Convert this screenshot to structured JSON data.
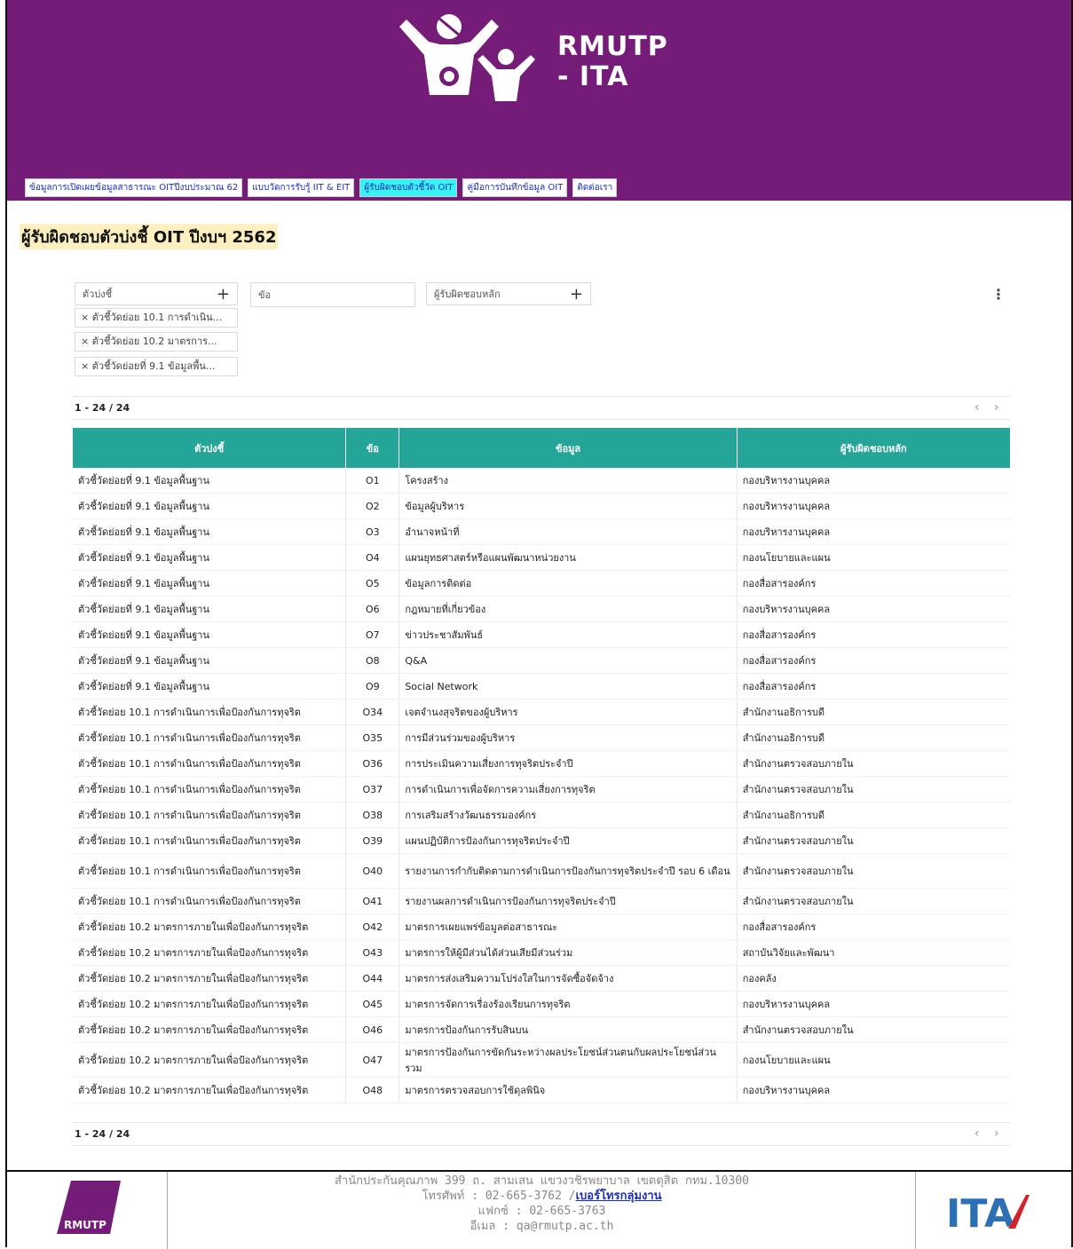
{
  "header": {
    "logo_text_line1": "RMUTP",
    "logo_text_line2": "- ITA"
  },
  "nav": [
    "ข้อมูลการเปิดเผยข้อมูลสาธารณะ OITปีงบประมาณ 62",
    "แบบวัดการรับรู้ IIT & EIT",
    "ผู้รับผิดชอบตัวชี้วัด OIT",
    "คู่มือการบันทึกข้อมูล OIT",
    "ติดต่อเรา"
  ],
  "page_title": "ผู้รับผิดชอบตัวบ่งชี้ OIT ปีงบฯ 2562",
  "filters": {
    "indicator_label": "ตัวบ่งชี้",
    "item_placeholder": "ข้อ",
    "owner_label": "ผู้รับผิดชอบหลัก",
    "plus": "+",
    "chips": [
      "× ตัวชี้วัดย่อย 10.1 การดำเนิน...",
      "× ตัวชี้วัดย่อย 10.2 มาตรการ...",
      "× ตัวชี้วัดย่อยที่ 9.1 ข้อมูลพื้น..."
    ]
  },
  "pager": {
    "text": "1 - 24 / 24",
    "arrows": "‹ ›"
  },
  "table": {
    "headers": [
      "ตัวบ่งชี้",
      "ข้อ",
      "ข้อมูล",
      "ผู้รับผิดชอบหลัก"
    ],
    "rows": [
      [
        "ตัวชี้วัดย่อยที่ 9.1 ข้อมูลพื้นฐาน",
        "O1",
        "โครงสร้าง",
        "กองบริหารงานบุคคล"
      ],
      [
        "ตัวชี้วัดย่อยที่ 9.1 ข้อมูลพื้นฐาน",
        "O2",
        "ข้อมูลผู้บริหาร",
        "กองบริหารงานบุคคล"
      ],
      [
        "ตัวชี้วัดย่อยที่ 9.1 ข้อมูลพื้นฐาน",
        "O3",
        "อำนาจหน้าที่",
        "กองบริหารงานบุคคล"
      ],
      [
        "ตัวชี้วัดย่อยที่ 9.1 ข้อมูลพื้นฐาน",
        "O4",
        "แผนยุทธศาสตร์หรือแผนพัฒนาหน่วยงาน",
        "กองนโยบายและแผน"
      ],
      [
        "ตัวชี้วัดย่อยที่ 9.1 ข้อมูลพื้นฐาน",
        "O5",
        "ข้อมูลการติดต่อ",
        "กองสื่อสารองค์กร"
      ],
      [
        "ตัวชี้วัดย่อยที่ 9.1 ข้อมูลพื้นฐาน",
        "O6",
        "กฎหมายที่เกี่ยวข้อง",
        "กองบริหารงานบุคคล"
      ],
      [
        "ตัวชี้วัดย่อยที่ 9.1 ข้อมูลพื้นฐาน",
        "O7",
        "ข่าวประชาสัมพันธ์",
        "กองสื่อสารองค์กร"
      ],
      [
        "ตัวชี้วัดย่อยที่ 9.1 ข้อมูลพื้นฐาน",
        "O8",
        "Q&A",
        "กองสื่อสารองค์กร"
      ],
      [
        "ตัวชี้วัดย่อยที่ 9.1 ข้อมูลพื้นฐาน",
        "O9",
        "Social Network",
        "กองสื่อสารองค์กร"
      ],
      [
        "ตัวชี้วัดย่อย 10.1 การดำเนินการเพื่อป้องกันการทุจริต",
        "O34",
        "เจตจำนงสุจริตของผู้บริหาร",
        "สำนักงานอธิการบดี"
      ],
      [
        "ตัวชี้วัดย่อย 10.1 การดำเนินการเพื่อป้องกันการทุจริต",
        "O35",
        "การมีส่วนร่วมของผู้บริหาร",
        "สำนักงานอธิการบดี"
      ],
      [
        "ตัวชี้วัดย่อย 10.1 การดำเนินการเพื่อป้องกันการทุจริต",
        "O36",
        "การประเมินความเสี่ยงการทุจริตประจำปี",
        "สำนักงานตรวจสอบภายใน"
      ],
      [
        "ตัวชี้วัดย่อย 10.1 การดำเนินการเพื่อป้องกันการทุจริต",
        "O37",
        "การดำเนินการเพื่อจัดการความเสี่ยงการทุจริต",
        "สำนักงานตรวจสอบภายใน"
      ],
      [
        "ตัวชี้วัดย่อย 10.1 การดำเนินการเพื่อป้องกันการทุจริต",
        "O38",
        "การเสริมสร้างวัฒนธรรมองค์กร",
        "สำนักงานอธิการบดี"
      ],
      [
        "ตัวชี้วัดย่อย 10.1 การดำเนินการเพื่อป้องกันการทุจริต",
        "O39",
        "แผนปฏิบัติการป้องกันการทุจริตประจำปี",
        "สำนักงานตรวจสอบภายใน"
      ],
      [
        "ตัวชี้วัดย่อย 10.1 การดำเนินการเพื่อป้องกันการทุจริต",
        "O40",
        "รายงานการกำกับติดตามการดำเนินการป้องกันการทุจริตประจำปี รอบ 6 เดือน",
        "สำนักงานตรวจสอบภายใน"
      ],
      [
        "ตัวชี้วัดย่อย 10.1 การดำเนินการเพื่อป้องกันการทุจริต",
        "O41",
        "รายงานผลการดำเนินการป้องกันการทุจริตประจำปี",
        "สำนักงานตรวจสอบภายใน"
      ],
      [
        "ตัวชี้วัดย่อย 10.2 มาตรการภายในเพื่อป้องกันการทุจริต",
        "O42",
        "มาตรการเผยแพร่ข้อมูลต่อสาธารณะ",
        "กองสื่อสารองค์กร"
      ],
      [
        "ตัวชี้วัดย่อย 10.2 มาตรการภายในเพื่อป้องกันการทุจริต",
        "O43",
        "มาตรการให้ผู้มีส่วนได้ส่วนเสียมีส่วนร่วม",
        "สถาบันวิจัยและพัฒนา"
      ],
      [
        "ตัวชี้วัดย่อย 10.2 มาตรการภายในเพื่อป้องกันการทุจริต",
        "O44",
        "มาตรการส่งเสริมความโปร่งใสในการจัดซื้อจัดจ้าง",
        "กองคลัง"
      ],
      [
        "ตัวชี้วัดย่อย 10.2 มาตรการภายในเพื่อป้องกันการทุจริต",
        "O45",
        "มาตรการจัดการเรื่องร้องเรียนการทุจริต",
        "กองบริหารงานบุคคล"
      ],
      [
        "ตัวชี้วัดย่อย 10.2 มาตรการภายในเพื่อป้องกันการทุจริต",
        "O46",
        "มาตรการป้องกันการรับสินบน",
        "สำนักงานตรวจสอบภายใน"
      ],
      [
        "ตัวชี้วัดย่อย 10.2 มาตรการภายในเพื่อป้องกันการทุจริต",
        "O47",
        "มาตรการป้องกันการขัดกันระหว่างผลประโยชน์ส่วนตนกับผลประโยชน์ส่วนรวม",
        "กองนโยบายและแผน"
      ],
      [
        "ตัวชี้วัดย่อย 10.2 มาตรการภายในเพื่อป้องกันการทุจริต",
        "O48",
        "มาตรการตรวจสอบการใช้ดุลพินิจ",
        "กองบริหารงานบุคคล"
      ]
    ]
  },
  "footer": {
    "line1": "สำนักประกันคุณภาพ 399 ถ. สามเสน แขวงวชิรพยาบาล เขตดุสิต กทม.10300",
    "phone_prefix": "โทรศัพท์ : 02-665-3762 /",
    "phone_link": "เบอร์โทรกลุ่มงาน",
    "fax": "แฟกซ์ : 02-665-3763",
    "email": "อีเมล : qa@rmutp.ac.th",
    "left_logo_text": "RMUTP",
    "right_logo_text": "ITA",
    "brand_color": "#751b78"
  }
}
